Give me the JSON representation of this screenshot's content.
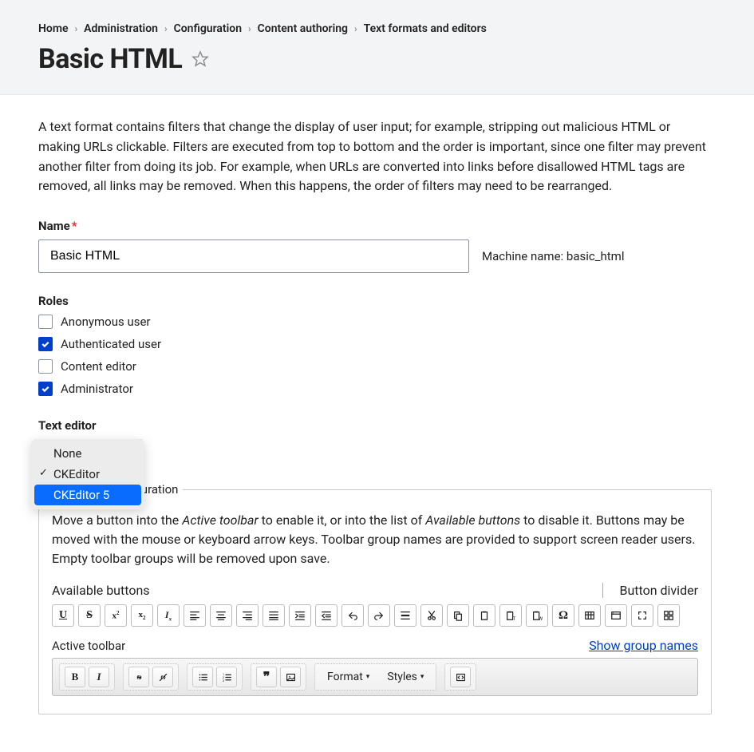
{
  "breadcrumb": [
    "Home",
    "Administration",
    "Configuration",
    "Content authoring",
    "Text formats and editors"
  ],
  "page_title": "Basic HTML",
  "intro": "A text format contains filters that change the display of user input; for example, stripping out malicious HTML or making URLs clickable. Filters are executed from top to bottom and the order is important, since one filter may prevent another filter from doing its job. For example, when URLs are converted into links before disallowed HTML tags are removed, all links may be removed. When this happens, the order of filters may need to be rearranged.",
  "name_field": {
    "label": "Name",
    "value": "Basic HTML"
  },
  "machine_name": {
    "label": "Machine name:",
    "value": "basic_html"
  },
  "roles": {
    "label": "Roles",
    "items": [
      {
        "label": "Anonymous user",
        "checked": false
      },
      {
        "label": "Authenticated user",
        "checked": true
      },
      {
        "label": "Content editor",
        "checked": false
      },
      {
        "label": "Administrator",
        "checked": true
      }
    ]
  },
  "text_editor": {
    "label": "Text editor",
    "selected": "CKEditor",
    "options": [
      "None",
      "CKEditor",
      "CKEditor 5"
    ],
    "highlighted": "CKEditor 5"
  },
  "toolbar_config": {
    "legend": "Toolbar configuration",
    "description_pre": "Move a button into the ",
    "description_em1": "Active toolbar",
    "description_mid": " to enable it, or into the list of ",
    "description_em2": "Available buttons",
    "description_post": " to disable it. Buttons may be moved with the mouse or keyboard arrow keys. Toolbar group names are provided to support screen reader users. Empty toolbar groups will be removed upon save.",
    "available_label": "Available buttons",
    "divider_label": "Button divider",
    "active_label": "Active toolbar",
    "show_group_names": "Show group names",
    "format_label": "Format",
    "styles_label": "Styles"
  },
  "available_buttons": [
    "underline",
    "strike",
    "superscript",
    "subscript",
    "remove-format",
    "align-left",
    "align-center",
    "align-right",
    "justify",
    "indent",
    "outdent",
    "undo",
    "redo",
    "horizontal-rule",
    "cut",
    "copy",
    "paste",
    "paste-text",
    "paste-word",
    "special-char",
    "table",
    "iframe",
    "maximize",
    "show-blocks"
  ],
  "active_toolbar_groups": [
    [
      "bold",
      "italic"
    ],
    [
      "link",
      "unlink"
    ],
    [
      "bullet-list",
      "numbered-list"
    ],
    [
      "blockquote",
      "image"
    ]
  ]
}
